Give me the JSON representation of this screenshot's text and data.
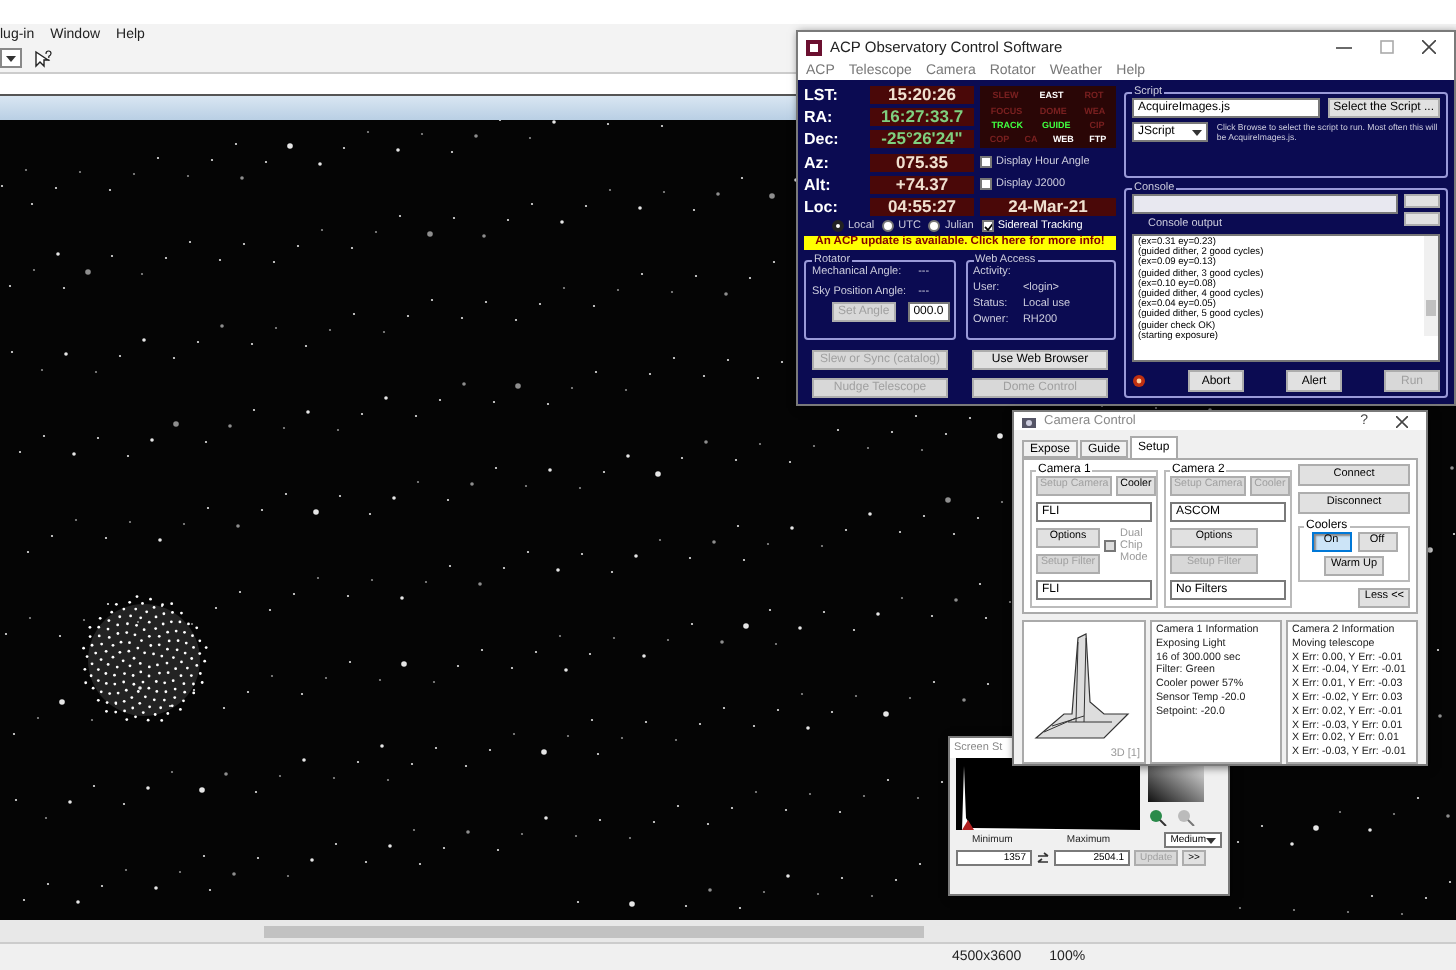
{
  "app": {
    "menu": [
      "lug-in",
      "Window",
      "Help"
    ],
    "status_bar": {
      "dimensions": "4500x3600",
      "zoom": "100%"
    }
  },
  "acp": {
    "title": "ACP Observatory Control Software",
    "menu": [
      "ACP",
      "Telescope",
      "Camera",
      "Rotator",
      "Weather",
      "Help"
    ],
    "readouts": [
      {
        "label": "LST:",
        "value": "15:20:26",
        "kind": "time"
      },
      {
        "label": "RA:",
        "value": "16:27:33.7",
        "kind": "equatorial"
      },
      {
        "label": "Dec:",
        "value": "-25°26'24\"",
        "kind": "equatorial"
      },
      {
        "label": "Az:",
        "value": "075.35",
        "kind": "horizontal"
      },
      {
        "label": "Alt:",
        "value": "+74.37",
        "kind": "horizontal"
      },
      {
        "label": "Loc:",
        "value": "04:55:27",
        "kind": "time"
      }
    ],
    "date": "24-Mar-21",
    "light_rows": [
      {
        "lights": [
          {
            "label": "SLEW",
            "on": false
          },
          {
            "label": "EAST",
            "on": true,
            "color": "#ffffff"
          },
          {
            "label": "ROT",
            "on": false
          }
        ]
      },
      {
        "lights": [
          {
            "label": "FOCUS",
            "on": false
          },
          {
            "label": "DOME",
            "on": false
          },
          {
            "label": "WEA",
            "on": false
          }
        ]
      },
      {
        "lights": [
          {
            "label": "TRACK",
            "on": true,
            "color": "#40ff40"
          },
          {
            "label": "GUIDE",
            "on": true,
            "color": "#40ff40"
          },
          {
            "label": "CIP",
            "on": false
          }
        ]
      },
      {
        "lights": [
          {
            "label": "COP",
            "on": false
          },
          {
            "label": "CA",
            "on": false
          },
          {
            "label": "WEB",
            "on": true,
            "color": "#ffffff"
          },
          {
            "label": "FTP",
            "on": true,
            "color": "#ffffff"
          }
        ]
      }
    ],
    "options": [
      {
        "label": "Display Hour Angle",
        "checked": false
      },
      {
        "label": "Display J2000",
        "checked": false
      }
    ],
    "time_modes": [
      {
        "label": "Local",
        "selected": true
      },
      {
        "label": "UTC",
        "selected": false
      },
      {
        "label": "Julian",
        "selected": false
      }
    ],
    "sidereal_tracking": {
      "label": "Sidereal Tracking",
      "checked": true
    },
    "update_banner": "An ACP update is available. Click here for more info!",
    "rotator": {
      "title": "Rotator",
      "rows": [
        {
          "label": "Mechanical Angle:",
          "value": "---"
        },
        {
          "label": "Sky Position Angle:",
          "value": "---"
        }
      ],
      "button": {
        "label": "Set Angle",
        "disabled": true
      },
      "angle": "000.0"
    },
    "web_access": {
      "title": "Web Access",
      "rows": [
        {
          "label": "Activity:"
        },
        {
          "label": "User:",
          "value": "<login>"
        },
        {
          "label": "Status:",
          "value": "Local use"
        },
        {
          "label": "Owner:",
          "value": "RH200"
        }
      ]
    },
    "buttons": [
      {
        "label": "Slew or Sync (catalog)",
        "disabled": true
      },
      {
        "label": "Use Web Browser",
        "disabled": false
      },
      {
        "label": "Nudge Telescope",
        "disabled": true
      },
      {
        "label": "Dome Control",
        "disabled": true
      }
    ],
    "script": {
      "title": "Script",
      "file": "AcquireImages.js",
      "select_button": "Select the Script ...",
      "language": "JScript",
      "hint": "Click Browse to select the script to run. Most often this will be AcquireImages.js."
    },
    "console": {
      "title": "Console",
      "output_label": "Console output",
      "lines": [
        "(ex=0.31 ey=0.23)",
        "(guided dither, 2 good cycles)",
        "(ex=0.09 ey=0.13)",
        "(guided dither, 3 good cycles)",
        "(ex=0.10 ey=0.08)",
        "(guided dither, 4 good cycles)",
        "(ex=0.04 ey=0.05)",
        "(guided dither, 5 good cycles)",
        "(guider check OK)",
        "(starting exposure)"
      ],
      "buttons": [
        {
          "label": "Abort",
          "disabled": false
        },
        {
          "label": "Alert",
          "disabled": false
        },
        {
          "label": "Run",
          "disabled": true
        }
      ]
    }
  },
  "camera": {
    "title": "Camera Control",
    "help": "?",
    "tabs": [
      {
        "label": "Expose",
        "selected": false
      },
      {
        "label": "Guide",
        "selected": false
      },
      {
        "label": "Setup",
        "selected": true
      }
    ],
    "cameras": [
      {
        "title": "Camera 1",
        "setup_camera": {
          "label": "Setup Camera",
          "disabled": true
        },
        "cooler": {
          "label": "Cooler",
          "disabled": false
        },
        "driver": "FLI",
        "options": {
          "label": "Options",
          "disabled": false
        },
        "setup_filter": {
          "label": "Setup Filter",
          "disabled": true
        },
        "filter": "FLI",
        "dual_chip": {
          "label": "Dual Chip Mode",
          "checked": false,
          "disabled": true
        }
      },
      {
        "title": "Camera 2",
        "setup_camera": {
          "label": "Setup Camera",
          "disabled": true
        },
        "cooler": {
          "label": "Cooler",
          "disabled": true
        },
        "driver": "ASCOM",
        "options": {
          "label": "Options",
          "disabled": false
        },
        "setup_filter": {
          "label": "Setup Filter",
          "disabled": true
        },
        "filter": "No Filters"
      }
    ],
    "connect": "Connect",
    "disconnect": "Disconnect",
    "coolers": {
      "title": "Coolers",
      "buttons": [
        {
          "label": "On",
          "selected": true
        },
        {
          "label": "Off",
          "selected": false
        }
      ],
      "warm_up": "Warm Up"
    },
    "less": "Less <<",
    "plot_label": "3D [1]",
    "info": [
      {
        "lines": [
          "Camera 1 Information",
          "Exposing Light",
          "16 of 300.000 sec",
          "Filter: Green",
          "Cooler power 57%",
          "Sensor Temp -20.0",
          "Setpoint: -20.0"
        ]
      },
      {
        "lines": [
          "Camera 2 Information",
          "Moving telescope",
          "X Err: 0.00, Y Err: -0.01",
          "X Err: -0.04, Y Err: -0.01",
          "X Err: 0.01, Y Err: -0.03",
          "X Err: -0.02, Y Err: 0.03",
          "X Err: 0.02, Y Err: -0.01",
          "X Err: -0.03, Y Err: 0.01",
          "X Err: 0.02, Y Err: 0.01",
          "X Err: -0.03, Y Err: -0.01"
        ]
      }
    ]
  },
  "stretch": {
    "title": "Screen St",
    "preset": "Medium",
    "minimum": {
      "label": "Minimum",
      "value": "1357"
    },
    "maximum": {
      "label": "Maximum",
      "value": "2504.1"
    },
    "update": {
      "label": "Update",
      "disabled": true
    },
    "more": ">>"
  }
}
